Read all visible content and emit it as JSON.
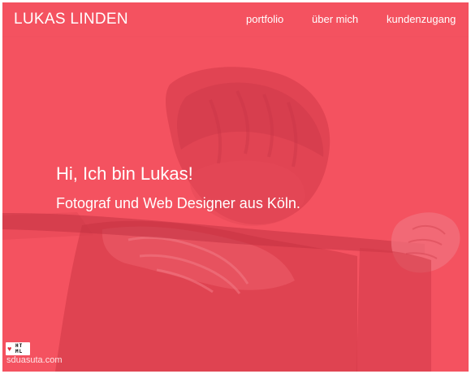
{
  "header": {
    "logo": "LUKAS LINDEN",
    "nav": [
      "portfolio",
      "über mich",
      "kundenzugang"
    ]
  },
  "hero": {
    "headline": "Hi, Ich bin Lukas!",
    "subline": "Fotograf und Web Designer aus Köln."
  },
  "badge": {
    "icon": "heart-icon",
    "text_top": "HT",
    "text_bottom": "ML"
  },
  "watermark": "sduasuta.com",
  "colors": {
    "accent": "#f4515f",
    "text": "#ffffff"
  }
}
